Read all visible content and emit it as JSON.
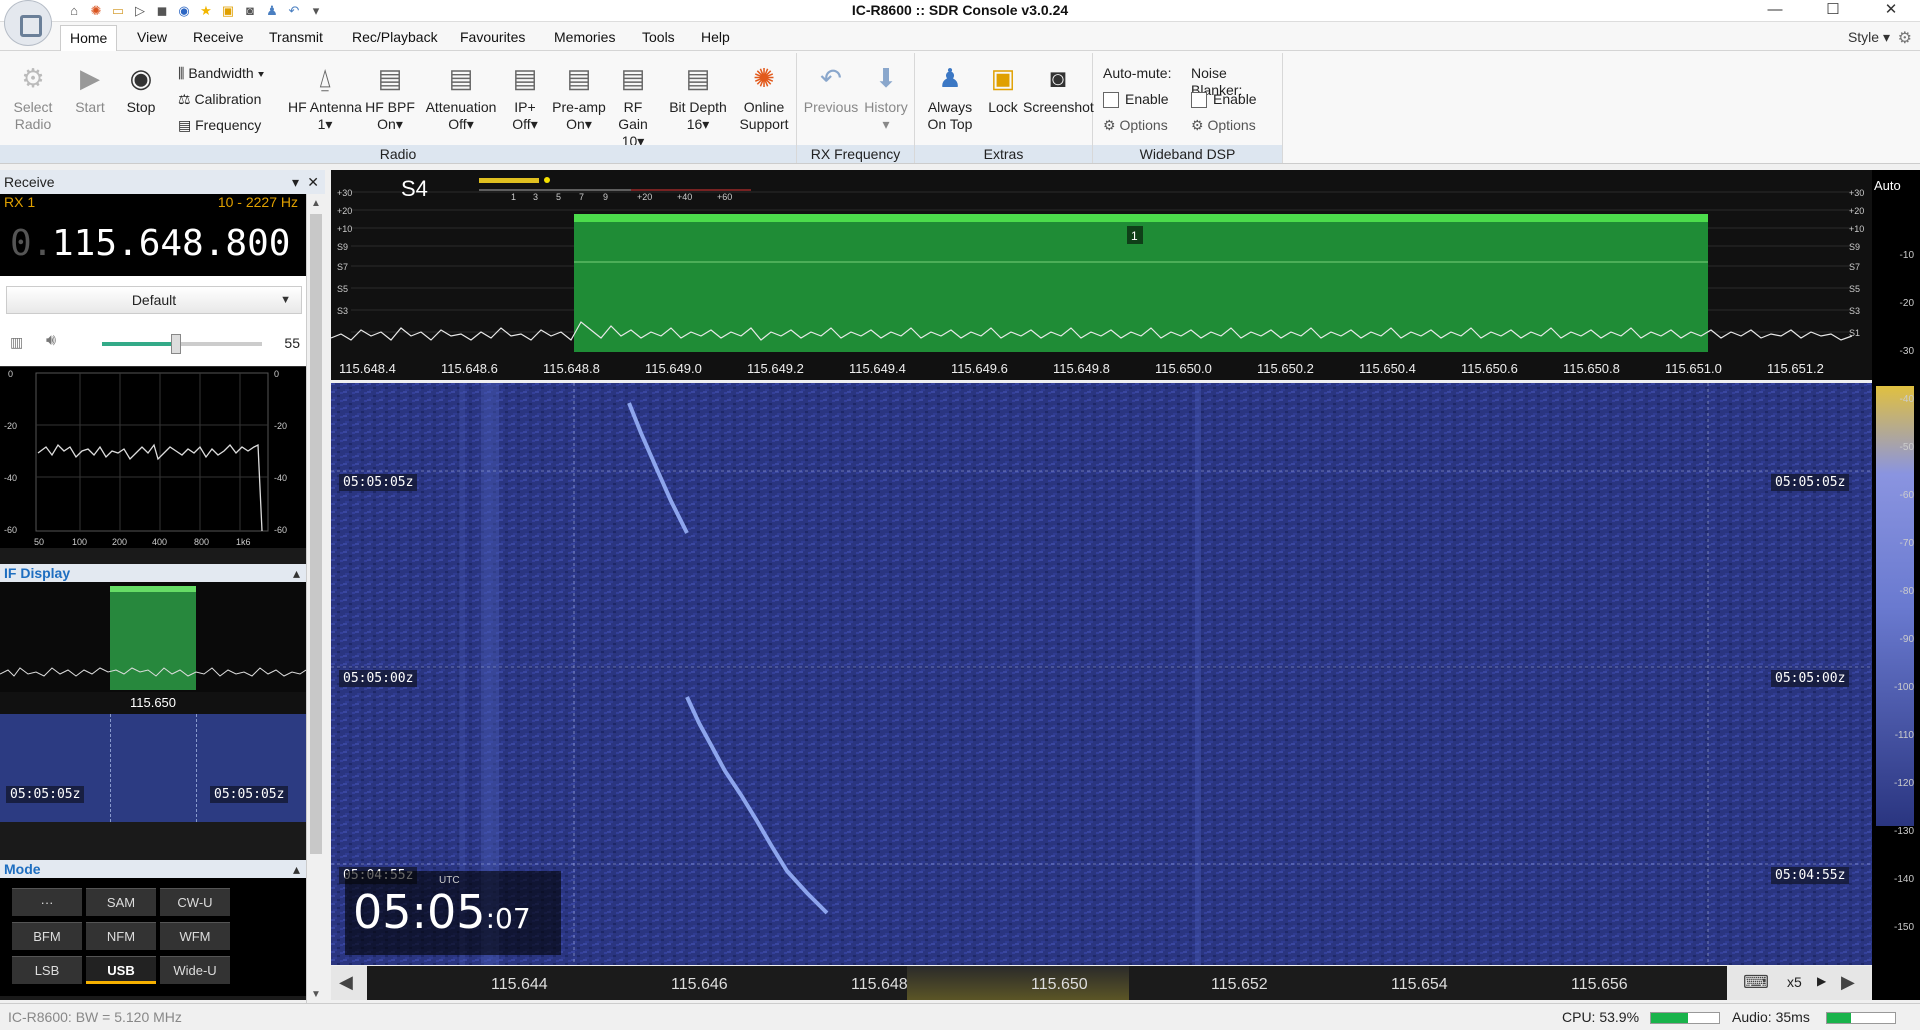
{
  "window": {
    "title": "IC-R8600 :: SDR Console v3.0.24",
    "minimize": "—",
    "maximize": "☐",
    "close": "✕"
  },
  "menu": {
    "tabs": [
      "Home",
      "View",
      "Receive",
      "Transmit",
      "Rec/Playback",
      "Favourites",
      "Memories",
      "Tools",
      "Help"
    ],
    "active": "Home",
    "style_label": "Style"
  },
  "ribbon": {
    "radio": {
      "title": "Radio",
      "select_radio": "Select\nRadio",
      "start": "Start",
      "stop": "Stop",
      "bandwidth": "Bandwidth",
      "calibration": "Calibration",
      "frequency": "Frequency",
      "hf_antenna": "HF Antenna",
      "hf_antenna_val": "1",
      "hf_bpf": "HF BPF",
      "hf_bpf_val": "On",
      "attenuation": "Attenuation",
      "attenuation_val": "Off",
      "ip_plus": "IP+",
      "ip_plus_val": "Off",
      "preamp": "Pre-amp",
      "preamp_val": "On",
      "rf_gain": "RF Gain",
      "rf_gain_val": "10",
      "bit_depth": "Bit Depth",
      "bit_depth_val": "16",
      "online_support": "Online",
      "online_support2": "Support"
    },
    "rx_frequency": {
      "title": "RX Frequency",
      "previous": "Previous",
      "history": "History"
    },
    "extras": {
      "title": "Extras",
      "always_on_top": "Always",
      "always_on_top2": "On Top",
      "lock": "Lock",
      "screenshot": "Screenshot"
    },
    "wideband_dsp": {
      "title": "Wideband DSP",
      "auto_mute": "Auto-mute:",
      "noise_blanker": "Noise Blanker:",
      "enable": "Enable",
      "options": "Options"
    }
  },
  "receive_panel": {
    "title": "Receive",
    "rx_label": "RX 1",
    "rx_range": "10 - 2227 Hz",
    "freq_prefix": "0.",
    "frequency": "115.648.800",
    "preset": "Default",
    "volume": "55",
    "volume_level": 0.46,
    "audio_axis_x": [
      "50",
      "100",
      "200",
      "400",
      "800",
      "1k6"
    ],
    "audio_axis_y": [
      "0",
      "-20",
      "-40",
      "-60"
    ]
  },
  "if_display": {
    "title": "IF Display",
    "center_freq": "115.650",
    "times": [
      "05:05:05z",
      "05:05:05z"
    ]
  },
  "mode_panel": {
    "title": "Mode",
    "modes": [
      "···",
      "SAM",
      "CW-U",
      "BFM",
      "NFM",
      "WFM",
      "LSB",
      "USB",
      "Wide-U"
    ],
    "selected": "USB"
  },
  "spectrum": {
    "smeter": "S4",
    "smeter_scale": [
      "1",
      "3",
      "5",
      "7",
      "9",
      "+20",
      "+40",
      "+60"
    ],
    "left_db": [
      "+30",
      "+20",
      "+10",
      "S9",
      "S7",
      "S5",
      "S3"
    ],
    "right_db": [
      "+30",
      "+20",
      "+10",
      "S9",
      "S7",
      "S5",
      "S3",
      "S1"
    ],
    "vfo_marker": "1",
    "freq_labels": [
      "115.648.4",
      "115.648.6",
      "115.648.8",
      "115.649.0",
      "115.649.2",
      "115.649.4",
      "115.649.6",
      "115.649.8",
      "115.650.0",
      "115.650.2",
      "115.650.4",
      "115.650.6",
      "115.650.8",
      "115.651.0",
      "115.651.2"
    ]
  },
  "waterfall": {
    "times_left": [
      "05:05:05z",
      "05:05:00z",
      "05:04:55z"
    ],
    "times_right": [
      "05:05:05z",
      "05:05:00z",
      "05:04:55z"
    ],
    "clock_utc": "UTC",
    "clock_hm": "05:05",
    "clock_s": ":07"
  },
  "overview": {
    "labels": [
      "115.644",
      "115.646",
      "115.648",
      "115.650",
      "115.652",
      "115.654",
      "115.656"
    ],
    "zoom": "x5"
  },
  "right_scale": {
    "auto": "Auto",
    "values": [
      "-10",
      "-20",
      "-30",
      "-40",
      "-50",
      "-60",
      "-70",
      "-80",
      "-90",
      "-100",
      "-110",
      "-120",
      "-130",
      "-140",
      "-150"
    ]
  },
  "status": {
    "left": "IC-R8600: BW = 5.120 MHz",
    "cpu": "CPU: 53.9%",
    "cpu_level": 0.54,
    "audio": "Audio: 35ms",
    "audio_level": 0.35
  },
  "colors": {
    "filter_green": "#2ea84a",
    "waterfall_blue": "#2a3580",
    "accent_amber": "#e0a000"
  }
}
